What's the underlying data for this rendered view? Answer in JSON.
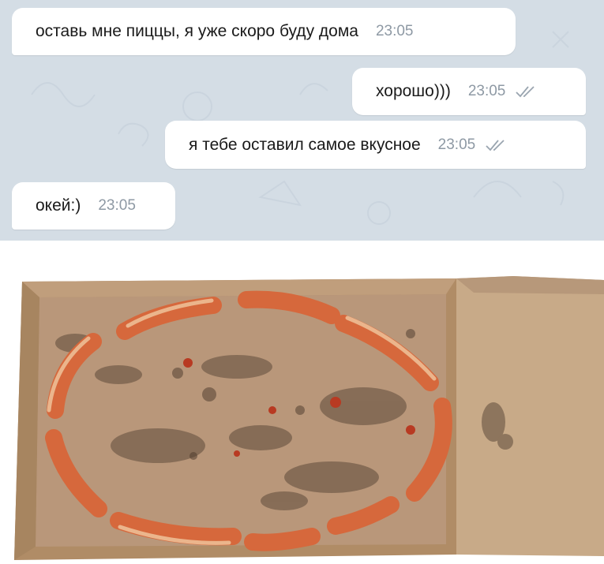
{
  "messages": [
    {
      "text": "оставь мне пиццы, я уже скоро буду дома",
      "time": "23:05",
      "direction": "incoming"
    },
    {
      "text": "хорошо)))",
      "time": "23:05",
      "direction": "outgoing",
      "status": "read"
    },
    {
      "text": "я тебе оставил самое вкусное",
      "time": "23:05",
      "direction": "outgoing",
      "status": "read"
    },
    {
      "text": "окей:)",
      "time": "23:05",
      "direction": "incoming"
    }
  ],
  "colors": {
    "chat_background": "#d4dde5",
    "bubble": "#ffffff",
    "timestamp": "#8e99a4",
    "read_check": "#9aa5b0"
  },
  "image": {
    "subject": "empty pizza box with only crusts left",
    "icon": "photo-icon"
  }
}
